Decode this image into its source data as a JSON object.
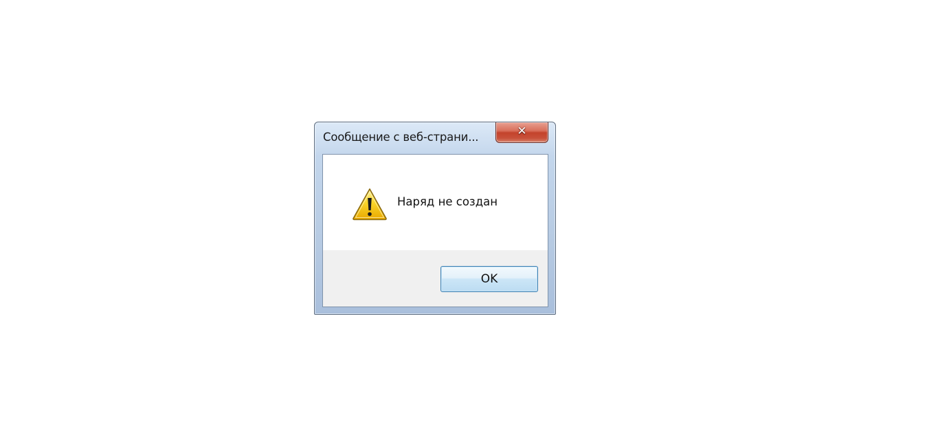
{
  "dialog": {
    "title": "Сообщение с веб-страни...",
    "message": "Наряд не создан",
    "icon": "warning-icon",
    "ok_label": "OK",
    "close_icon": "close-icon"
  },
  "colors": {
    "close_button": "#c4432c",
    "ok_border": "#3c7fb1",
    "button_area": "#f0f0f0",
    "warning_yellow": "#f5c400"
  }
}
